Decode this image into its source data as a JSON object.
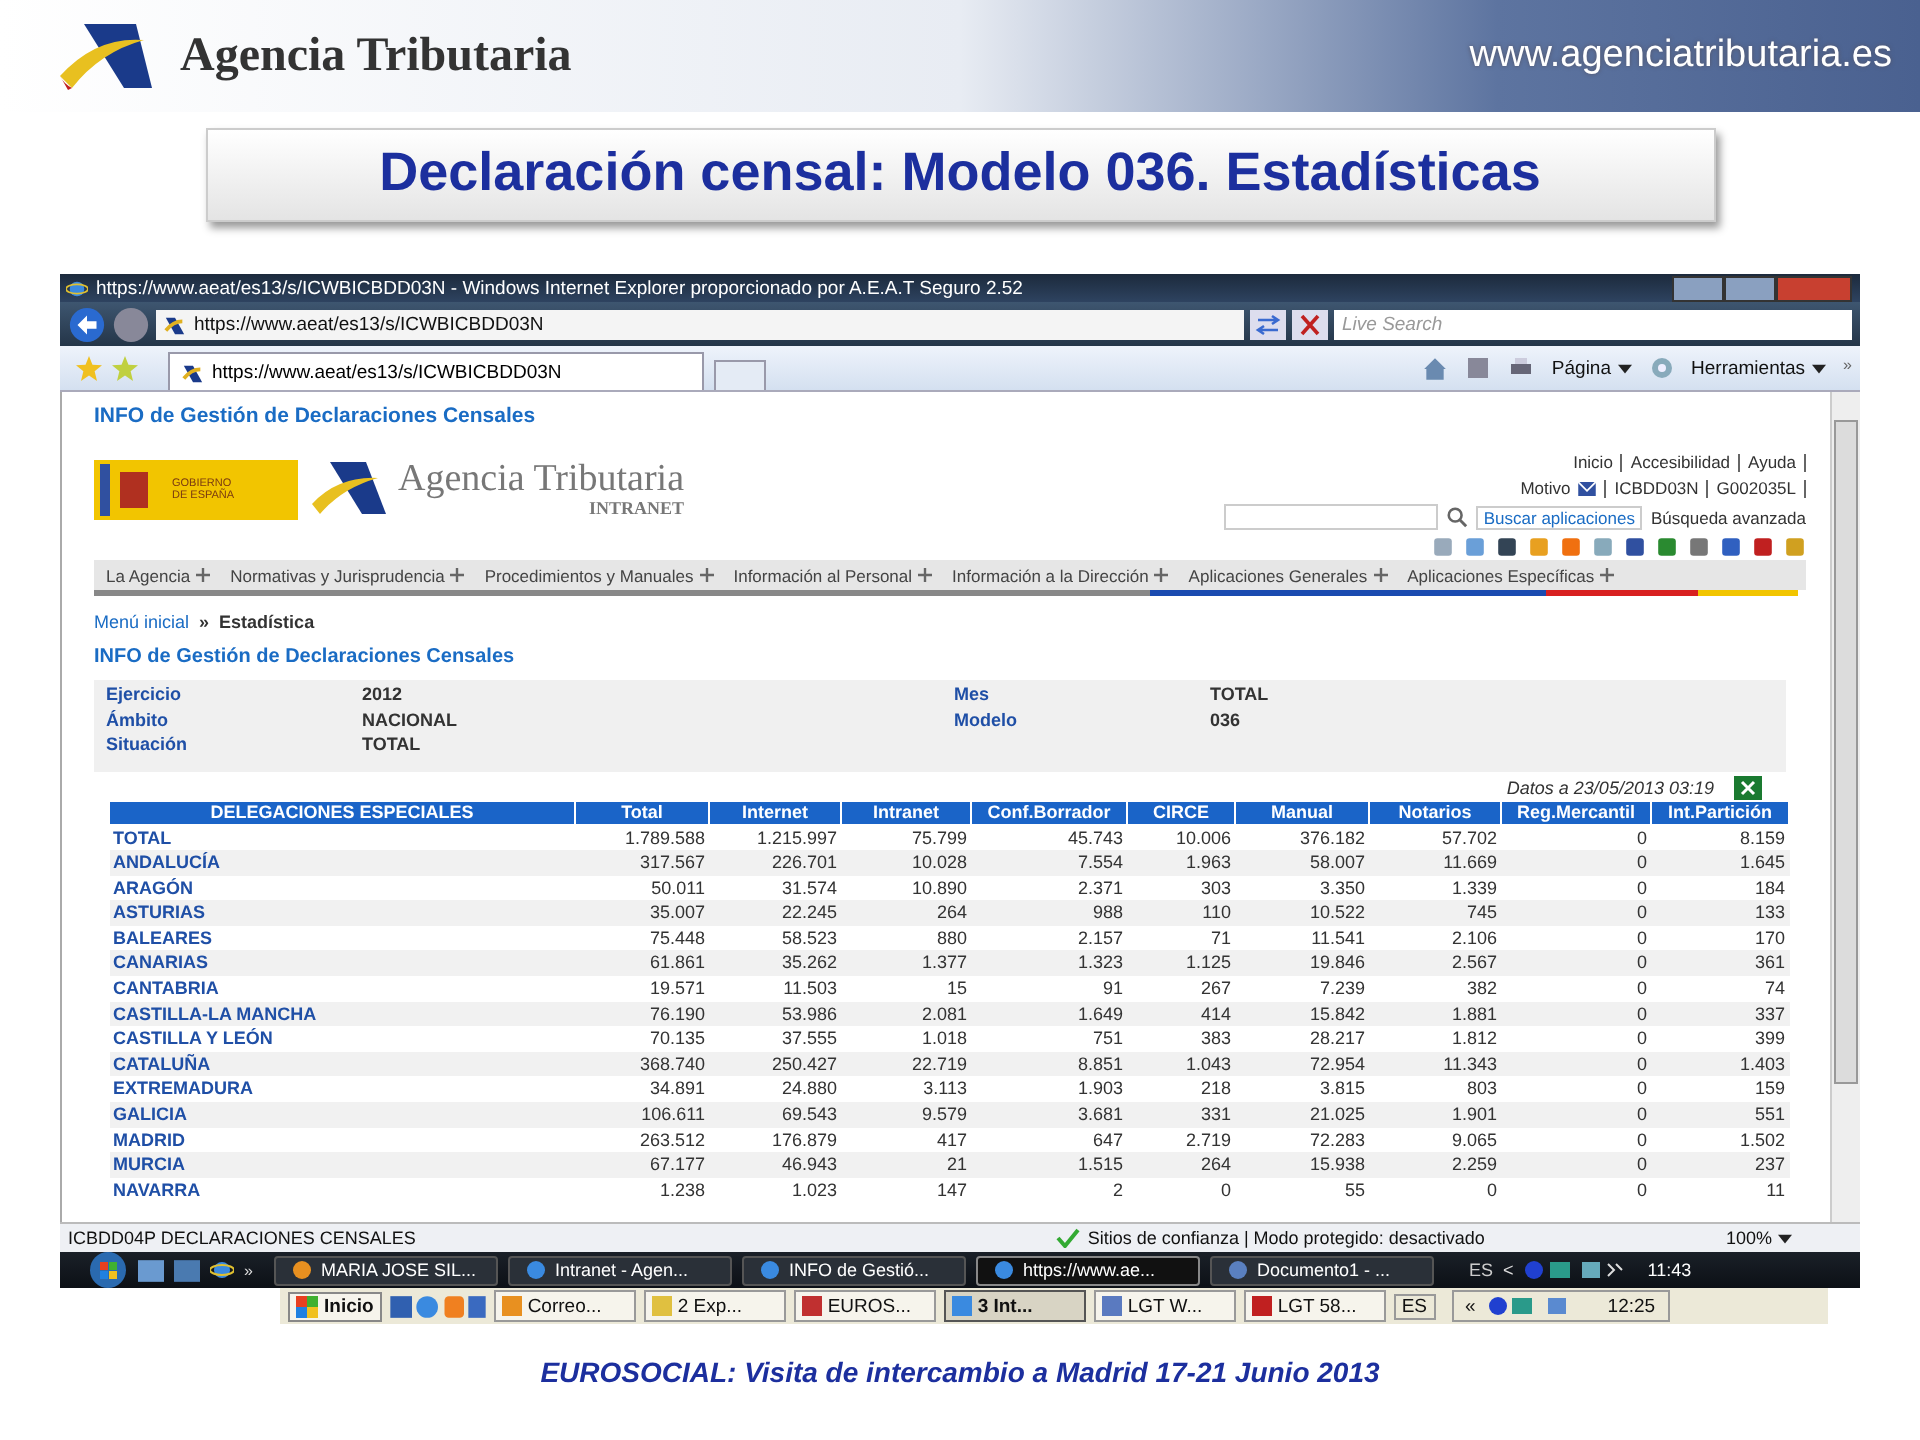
{
  "slide": {
    "brand": "Agencia Tributaria",
    "website": "www.agenciatributaria.es",
    "title": "Declaración censal: Modelo 036. Estadísticas",
    "footer": "EUROSOCIAL: Visita de intercambio a Madrid 17-21 Junio 2013"
  },
  "browser": {
    "title": "https://www.aeat/es13/s/ICWBICBDD03N - Windows Internet Explorer proporcionado por A.E.A.T Seguro 2.52",
    "address": "https://www.aeat/es13/s/ICWBICBDD03N",
    "search_placeholder": "Live Search",
    "tab": "https://www.aeat/es13/s/ICWBICBDD03N",
    "commands": [
      "Página",
      "Herramientas"
    ],
    "overflow": "»"
  },
  "page": {
    "heading": "INFO de Gestión de Declaraciones Censales",
    "logo_title": "Agencia Tributaria",
    "logo_sub": "INTRANET",
    "gov_lines": [
      "GOBIERNO",
      "DE ESPAÑA"
    ],
    "top_links": [
      "Inicio",
      "Accesibilidad",
      "Ayuda"
    ],
    "user_links": [
      "Motivo",
      "ICBDD03N",
      "G002035L"
    ],
    "search_button": "Buscar aplicaciones",
    "advanced_search": "Búsqueda avanzada",
    "menu": [
      "La Agencia",
      "Normativas y Jurisprudencia",
      "Procedimientos y Manuales",
      "Información al Personal",
      "Información a la Dirección",
      "Aplicaciones Generales",
      "Aplicaciones Específicas"
    ],
    "breadcrumb": {
      "link": "Menú inicial",
      "separator": "»",
      "current": "Estadística"
    },
    "section_title": "INFO de Gestión de Declaraciones Censales",
    "info_left": [
      {
        "label": "Ejercicio",
        "value": "2012"
      },
      {
        "label": "Ámbito",
        "value": "NACIONAL"
      },
      {
        "label": "Situación",
        "value": "TOTAL"
      }
    ],
    "info_right": [
      {
        "label": "Mes",
        "value": "TOTAL"
      },
      {
        "label": "Modelo",
        "value": "036"
      }
    ],
    "updated": "Datos a 23/05/2013  03:19",
    "table": {
      "columns": [
        "DELEGACIONES ESPECIALES",
        "Total",
        "Internet",
        "Intranet",
        "Conf.Borrador",
        "CIRCE",
        "Manual",
        "Notarios",
        "Reg.Mercantil",
        "Int.Partición"
      ],
      "rows": [
        {
          "name": "TOTAL",
          "values": [
            "1.789.588",
            "1.215.997",
            "75.799",
            "45.743",
            "10.006",
            "376.182",
            "57.702",
            "0",
            "8.159"
          ]
        },
        {
          "name": "ANDALUCÍA",
          "values": [
            "317.567",
            "226.701",
            "10.028",
            "7.554",
            "1.963",
            "58.007",
            "11.669",
            "0",
            "1.645"
          ]
        },
        {
          "name": "ARAGÓN",
          "values": [
            "50.011",
            "31.574",
            "10.890",
            "2.371",
            "303",
            "3.350",
            "1.339",
            "0",
            "184"
          ]
        },
        {
          "name": "ASTURIAS",
          "values": [
            "35.007",
            "22.245",
            "264",
            "988",
            "110",
            "10.522",
            "745",
            "0",
            "133"
          ]
        },
        {
          "name": "BALEARES",
          "values": [
            "75.448",
            "58.523",
            "880",
            "2.157",
            "71",
            "11.541",
            "2.106",
            "0",
            "170"
          ]
        },
        {
          "name": "CANARIAS",
          "values": [
            "61.861",
            "35.262",
            "1.377",
            "1.323",
            "1.125",
            "19.846",
            "2.567",
            "0",
            "361"
          ]
        },
        {
          "name": "CANTABRIA",
          "values": [
            "19.571",
            "11.503",
            "15",
            "91",
            "267",
            "7.239",
            "382",
            "0",
            "74"
          ]
        },
        {
          "name": "CASTILLA-LA MANCHA",
          "values": [
            "76.190",
            "53.986",
            "2.081",
            "1.649",
            "414",
            "15.842",
            "1.881",
            "0",
            "337"
          ]
        },
        {
          "name": "CASTILLA Y LEÓN",
          "values": [
            "70.135",
            "37.555",
            "1.018",
            "751",
            "383",
            "28.217",
            "1.812",
            "0",
            "399"
          ]
        },
        {
          "name": "CATALUÑA",
          "values": [
            "368.740",
            "250.427",
            "22.719",
            "8.851",
            "1.043",
            "72.954",
            "11.343",
            "0",
            "1.403"
          ]
        },
        {
          "name": "EXTREMADURA",
          "values": [
            "34.891",
            "24.880",
            "3.113",
            "1.903",
            "218",
            "3.815",
            "803",
            "0",
            "159"
          ]
        },
        {
          "name": "GALICIA",
          "values": [
            "106.611",
            "69.543",
            "9.579",
            "3.681",
            "331",
            "21.025",
            "1.901",
            "0",
            "551"
          ]
        },
        {
          "name": "MADRID",
          "values": [
            "263.512",
            "176.879",
            "417",
            "647",
            "2.719",
            "72.283",
            "9.065",
            "0",
            "1.502"
          ]
        },
        {
          "name": "MURCIA",
          "values": [
            "67.177",
            "46.943",
            "21",
            "1.515",
            "264",
            "15.938",
            "2.259",
            "0",
            "237"
          ]
        },
        {
          "name": "NAVARRA",
          "values": [
            "1.238",
            "1.023",
            "147",
            "2",
            "0",
            "55",
            "0",
            "0",
            "11"
          ]
        }
      ]
    }
  },
  "status_bar": {
    "text": "ICBDD04P DECLARACIONES CENSALES",
    "security": "Sitios de confianza | Modo protegido: desactivado",
    "zoom": "100%"
  },
  "taskbar": {
    "overflow": "»",
    "items": [
      {
        "label": "MARIA JOSE SIL...",
        "selected": false
      },
      {
        "label": "Intranet - Agen...",
        "selected": false
      },
      {
        "label": "INFO de Gestió...",
        "selected": false
      },
      {
        "label": "https://www.ae...",
        "selected": true
      },
      {
        "label": "Documento1 - ...",
        "selected": false
      }
    ],
    "lang": "ES",
    "tray": "<",
    "clock": "11:43"
  },
  "taskbar_back": {
    "start": "Inicio",
    "items": [
      {
        "label": "Correo...",
        "selected": false
      },
      {
        "label": "2 Exp...",
        "selected": false
      },
      {
        "label": "EUROS...",
        "selected": false
      },
      {
        "label": "3 Int...",
        "selected": true
      },
      {
        "label": "LGT W...",
        "selected": false
      },
      {
        "label": "LGT 58...",
        "selected": false
      }
    ],
    "lang": "ES",
    "tray": "«",
    "clock": "12:25"
  }
}
